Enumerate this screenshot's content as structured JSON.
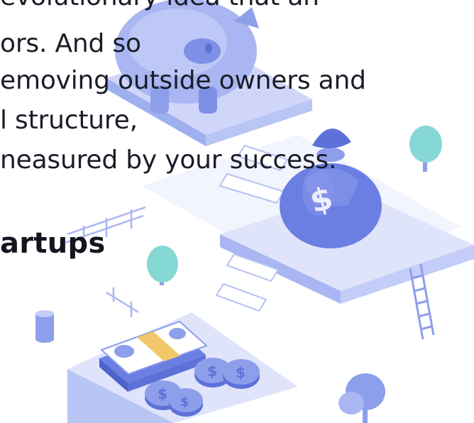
{
  "article": {
    "paragraph_lines": [
      "evolutionary idea that an",
      "ors. And so",
      "emoving outside owners and",
      "l structure,",
      "neasured by your success."
    ],
    "heading": "artups"
  },
  "illustration": {
    "coin_symbol": "$",
    "colors": {
      "primary": "#6b7fe3",
      "light": "#a9b6f2",
      "pale": "#dfe4fb",
      "platform_top": "#cfd6fa",
      "tree_aqua": "#86d8d4",
      "band_yellow": "#f2c76a"
    }
  }
}
